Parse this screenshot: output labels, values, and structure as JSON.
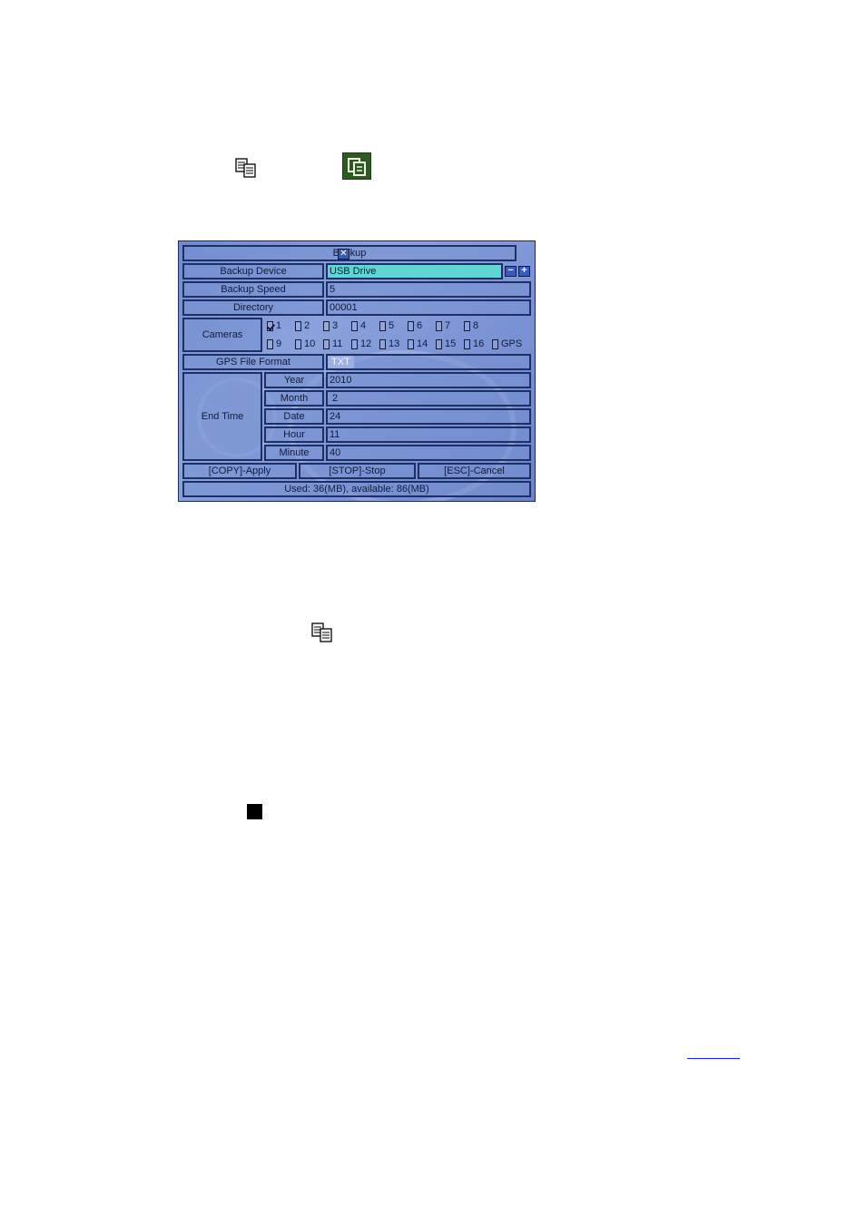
{
  "dialog": {
    "title": "Backup",
    "close_symbol": "✕",
    "rows": {
      "backup_device": {
        "label": "Backup Device",
        "value": "USB Drive"
      },
      "backup_speed": {
        "label": "Backup Speed",
        "value": "5"
      },
      "directory": {
        "label": "Directory",
        "value": "00001"
      },
      "cameras_label": "Cameras",
      "gps_file_format": {
        "label": "GPS File Format",
        "value": "TXT"
      },
      "end_time_label": "End Time",
      "year": {
        "label": "Year",
        "value": "2010"
      },
      "month": {
        "label": "Month",
        "value": "2"
      },
      "date": {
        "label": "Date",
        "value": "24"
      },
      "hour": {
        "label": "Hour",
        "value": "11"
      },
      "minute": {
        "label": "Minute",
        "value": "40"
      }
    },
    "cameras": [
      {
        "label": "1",
        "checked": true
      },
      {
        "label": "2",
        "checked": false
      },
      {
        "label": "3",
        "checked": false
      },
      {
        "label": "4",
        "checked": false
      },
      {
        "label": "5",
        "checked": false
      },
      {
        "label": "6",
        "checked": false
      },
      {
        "label": "7",
        "checked": false
      },
      {
        "label": "8",
        "checked": false
      },
      {
        "label": "9",
        "checked": false
      },
      {
        "label": "10",
        "checked": false
      },
      {
        "label": "11",
        "checked": false
      },
      {
        "label": "12",
        "checked": false
      },
      {
        "label": "13",
        "checked": false
      },
      {
        "label": "14",
        "checked": false
      },
      {
        "label": "15",
        "checked": false
      },
      {
        "label": "16",
        "checked": false
      },
      {
        "label": "GPS",
        "checked": false
      }
    ],
    "minus_symbol": "−",
    "plus_symbol": "+",
    "buttons": {
      "apply": "[COPY]-Apply",
      "stop": "[STOP]-Stop",
      "cancel": "[ESC]-Cancel"
    },
    "status": "Used: 36(MB), available: 86(MB)"
  },
  "icons": {
    "copy_icon": "copy-icon",
    "backup_icon": "backup-icon",
    "stop_icon": "stop-square-icon"
  },
  "colors": {
    "highlight": "#5fd6d4",
    "dialog_bg": "#7e96d6",
    "border": "#1e2f66"
  }
}
